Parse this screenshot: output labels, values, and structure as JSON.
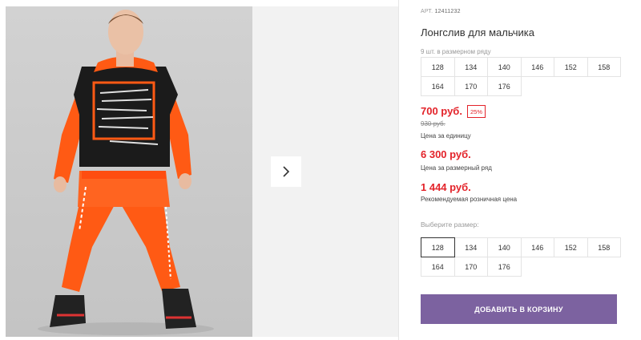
{
  "product": {
    "article_label": "АРТ.",
    "article_value": "12411232",
    "title": "Лонгслив для мальчика",
    "size_row_label": "9 шт. в размерном ряду",
    "size_row": [
      "128",
      "134",
      "140",
      "146",
      "152",
      "158",
      "164",
      "170",
      "176"
    ]
  },
  "pricing": {
    "price": "700 руб.",
    "discount": "25%",
    "old_price": "930 руб.",
    "price_note": "Цена за единицу",
    "row_price": "6 300 руб.",
    "row_note": "Цена за размерный ряд",
    "rrp": "1 444 руб.",
    "rrp_note": "Рекомендуемая розничная цена"
  },
  "size_picker": {
    "label": "Выберите размер:",
    "options": [
      "128",
      "134",
      "140",
      "146",
      "152",
      "158",
      "164",
      "170",
      "176"
    ],
    "selected": "128"
  },
  "actions": {
    "add_to_cart": "ДОБАВИТЬ В КОРЗИНУ"
  },
  "colors": {
    "price_red": "#e3232a",
    "button_purple": "#7c62a0",
    "garment_orange": "#ff5a14",
    "shirt_black": "#1b1b1b"
  },
  "icons": {
    "next": "chevron-right-icon"
  }
}
